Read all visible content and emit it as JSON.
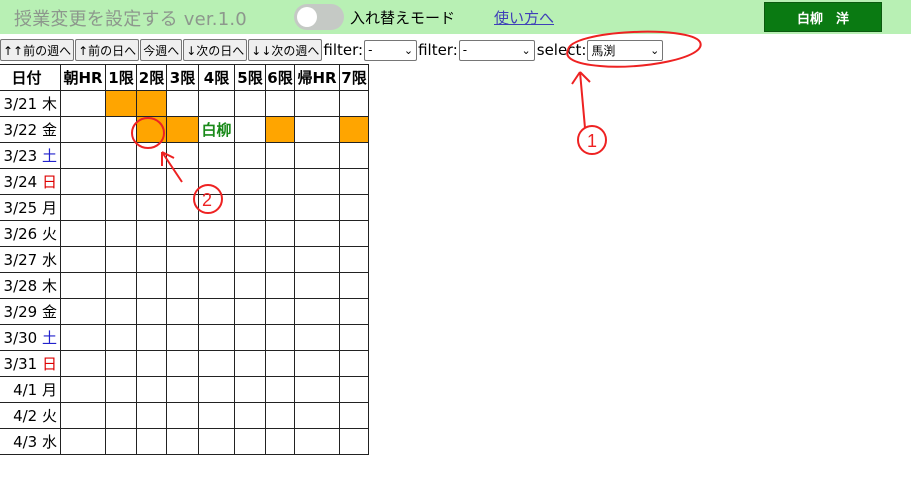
{
  "header": {
    "title": "授業変更を設定する ver.1.0",
    "toggle_label": "入れ替えモード",
    "usage_link": "使い方へ",
    "user_button": "白柳　洋"
  },
  "toolbar": {
    "buttons": [
      "↑↑前の週へ",
      "↑前の日へ",
      "今週へ",
      "↓次の日へ",
      "↓↓次の週へ"
    ],
    "filter_label_1": "filter:",
    "filter_value_1": "-",
    "filter_label_2": "filter:",
    "filter_value_2": "-",
    "select_label": "select:",
    "select_value": "馬渕"
  },
  "table": {
    "headers": [
      "日付",
      "朝HR",
      "1限",
      "2限",
      "3限",
      "4限",
      "5限",
      "6限",
      "帰HR",
      "7限"
    ],
    "rows": [
      {
        "date": "3/21 ",
        "dow": "木",
        "dow_type": "weekday"
      },
      {
        "date": "3/22 ",
        "dow": "金",
        "dow_type": "weekday"
      },
      {
        "date": "3/23 ",
        "dow": "土",
        "dow_type": "sat"
      },
      {
        "date": "3/24 ",
        "dow": "日",
        "dow_type": "sun"
      },
      {
        "date": "3/25 ",
        "dow": "月",
        "dow_type": "weekday"
      },
      {
        "date": "3/26 ",
        "dow": "火",
        "dow_type": "weekday"
      },
      {
        "date": "3/27 ",
        "dow": "水",
        "dow_type": "weekday"
      },
      {
        "date": "3/28 ",
        "dow": "木",
        "dow_type": "weekday"
      },
      {
        "date": "3/29 ",
        "dow": "金",
        "dow_type": "weekday"
      },
      {
        "date": "3/30 ",
        "dow": "土",
        "dow_type": "sat"
      },
      {
        "date": "3/31 ",
        "dow": "日",
        "dow_type": "sun"
      },
      {
        "date": "4/1 ",
        "dow": "月",
        "dow_type": "weekday"
      },
      {
        "date": "4/2 ",
        "dow": "火",
        "dow_type": "weekday"
      },
      {
        "date": "4/3 ",
        "dow": "水",
        "dow_type": "weekday"
      }
    ],
    "highlighted": [
      [
        0,
        2
      ],
      [
        0,
        3
      ],
      [
        1,
        3
      ],
      [
        1,
        4
      ],
      [
        1,
        7
      ],
      [
        1,
        9
      ]
    ],
    "cell_text": {
      "1,5": "白柳"
    },
    "highlight_color": "#ffa500"
  },
  "annotations": {
    "color": "#ee2222",
    "marks": [
      "①",
      "②"
    ]
  }
}
